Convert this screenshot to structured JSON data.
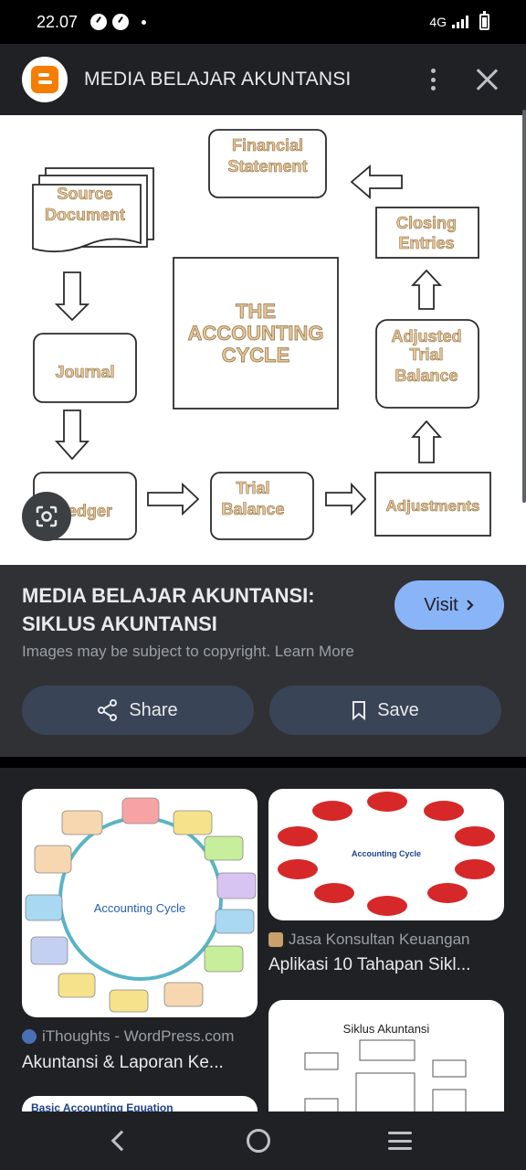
{
  "status_bar": {
    "time": "22.07",
    "network": "4G"
  },
  "header": {
    "site_title": "MEDIA BELAJAR AKUNTANSI",
    "logo_icon": "blogger-icon"
  },
  "main_image": {
    "financial_statement": [
      "Financial",
      "Statement"
    ],
    "source_document": [
      "Source",
      "Document"
    ],
    "closing_entries": [
      "Closing",
      "Entries"
    ],
    "center": [
      "THE",
      "ACCOUNTING",
      "CYCLE"
    ],
    "journal": "Journal",
    "adjusted_trial_balance": [
      "Adjusted",
      "Trial",
      "Balance"
    ],
    "ledger": "Ledger",
    "trial_balance": [
      "Trial",
      "Balance"
    ],
    "adjustments": "Adjustments"
  },
  "result": {
    "title": "MEDIA BELAJAR AKUNTANSI: SIKLUS AKUNTANSI",
    "visit_label": "Visit",
    "copyright": "Images may be subject to copyright. Learn More",
    "share_label": "Share",
    "save_label": "Save"
  },
  "related": [
    {
      "source": "iThoughts - WordPress.com",
      "title": "Akuntansi & Laporan Ke...",
      "image_caption": "Accounting Cycle"
    },
    {
      "source": "Jasa Konsultan Keuangan",
      "title": "Aplikasi 10 Tahapan Sikl...",
      "image_caption": "Accounting Cycle"
    },
    {
      "image_caption": "Basic Accounting Equation"
    },
    {
      "image_caption": "Siklus Akuntansi"
    }
  ],
  "colors": {
    "accent": "#8ab4f8",
    "button_bg": "#394457",
    "panel": "#303134",
    "blogger": "#f57d00"
  }
}
